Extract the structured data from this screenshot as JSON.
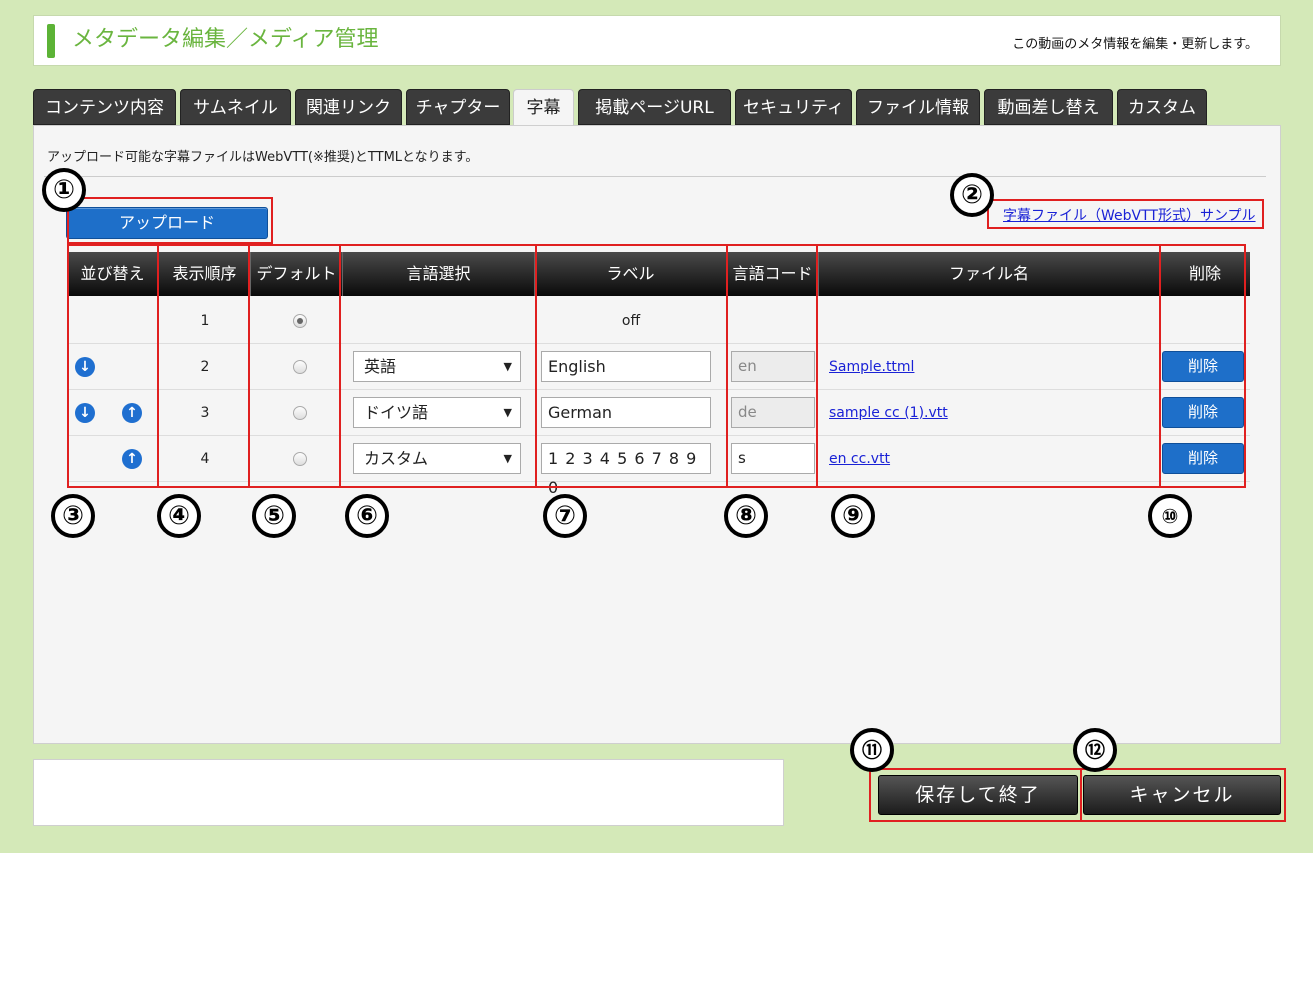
{
  "header": {
    "title": "メタデータ編集／メディア管理",
    "description": "この動画のメタ情報を編集・更新します。"
  },
  "tabs": [
    {
      "label": "コンテンツ内容"
    },
    {
      "label": "サムネイル"
    },
    {
      "label": "関連リンク"
    },
    {
      "label": "チャプター"
    },
    {
      "label": "字幕",
      "active": true
    },
    {
      "label": "掲載ページURL"
    },
    {
      "label": "セキュリティ"
    },
    {
      "label": "ファイル情報"
    },
    {
      "label": "動画差し替え"
    },
    {
      "label": "カスタム"
    }
  ],
  "info_text": "アップロード可能な字幕ファイルはWebVTT(※推奨)とTTMLとなります。",
  "upload_label": "アップロード",
  "sample_link": "字幕ファイル（WebVTT形式）サンプル",
  "table": {
    "headers": {
      "sort": "並び替え",
      "order": "表示順序",
      "default": "デフォルト",
      "lang": "言語選択",
      "label": "ラベル",
      "code": "言語コード",
      "file": "ファイル名",
      "delete": "削除"
    },
    "rows": [
      {
        "order": "1",
        "label_text": "off",
        "default": true
      },
      {
        "order": "2",
        "lang": "英語",
        "label": "English",
        "code": "en",
        "file": "Sample.ttml",
        "delete": "削除"
      },
      {
        "order": "3",
        "lang": "ドイツ語",
        "label": "German",
        "code": "de",
        "file": "sample cc (1).vtt",
        "delete": "削除"
      },
      {
        "order": "4",
        "lang": "カスタム",
        "label": "1 2 3 4 5 6 7 8 9 0",
        "code": "s",
        "file": "en cc.vtt",
        "delete": "削除"
      }
    ]
  },
  "annotations": [
    "①",
    "②",
    "③",
    "④",
    "⑤",
    "⑥",
    "⑦",
    "⑧",
    "⑨",
    "⑩",
    "⑪",
    "⑫"
  ],
  "buttons": {
    "save": "保存して終了",
    "cancel": "キャンセル"
  },
  "colors": {
    "background": "#d4e9b8",
    "accent_green": "#6ab53f",
    "button_blue": "#1e6fc9",
    "annotation_red": "#e02020"
  }
}
